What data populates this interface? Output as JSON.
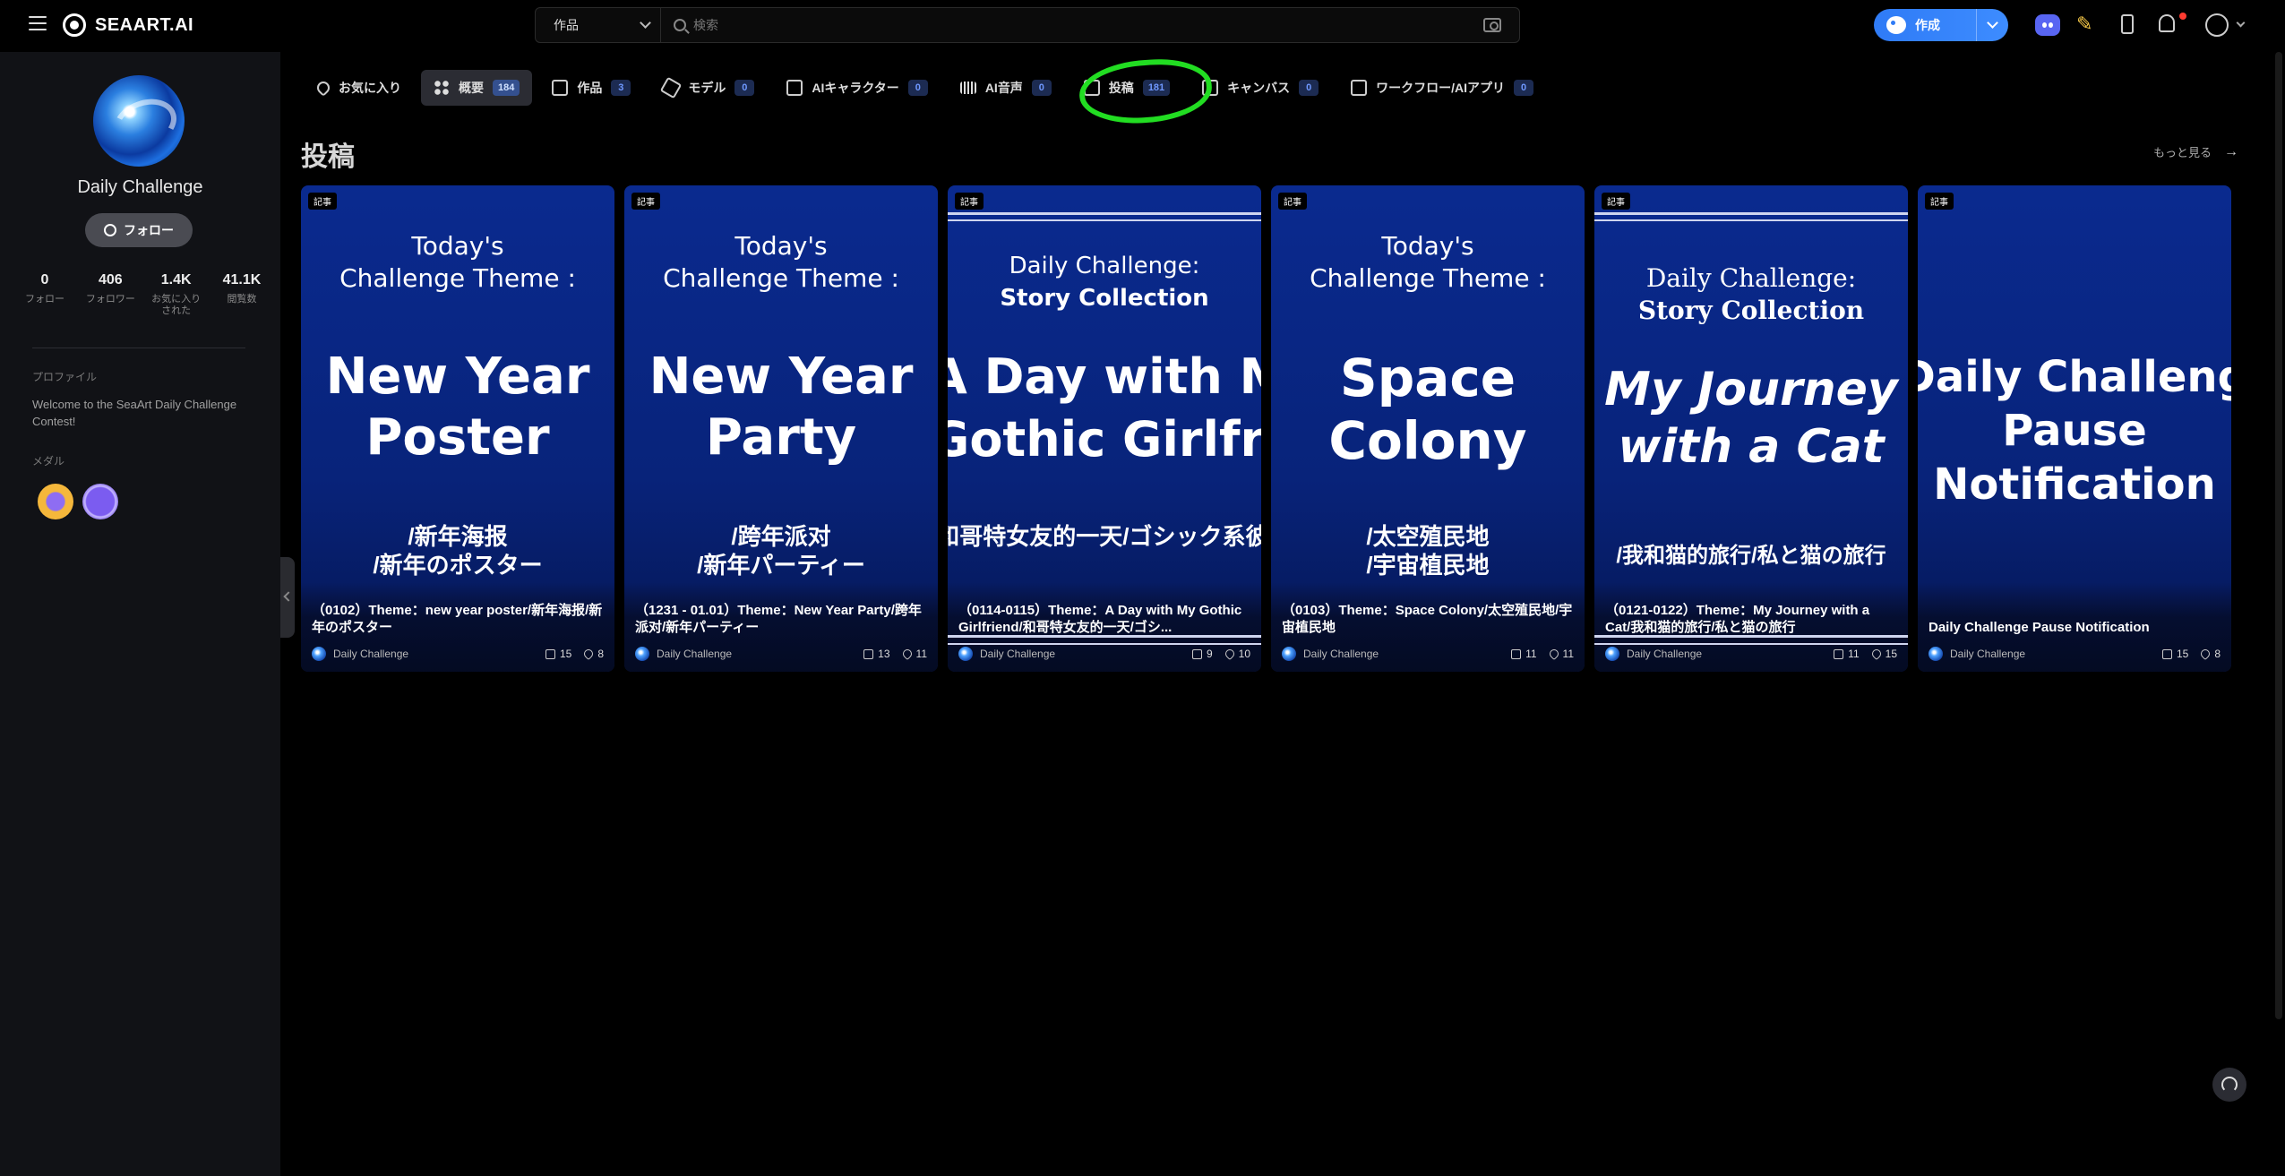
{
  "app": {
    "logo_text": "SEAART.AI"
  },
  "search": {
    "category": "作品",
    "placeholder": "検索"
  },
  "header": {
    "create_label": "作成"
  },
  "profile": {
    "name": "Daily Challenge",
    "follow_label": "フォロー",
    "stats": [
      {
        "value": "0",
        "label": "フォロー"
      },
      {
        "value": "406",
        "label": "フォロワー"
      },
      {
        "value": "1.4K",
        "label": "お気に入りされた"
      },
      {
        "value": "41.1K",
        "label": "閲覧数"
      }
    ],
    "profile_heading": "プロファイル",
    "bio": "Welcome to the SeaArt Daily Challenge Contest!",
    "medals_heading": "メダル"
  },
  "tabs": [
    {
      "label": "お気に入り",
      "count": ""
    },
    {
      "label": "概要",
      "count": "184"
    },
    {
      "label": "作品",
      "count": "3"
    },
    {
      "label": "モデル",
      "count": "0"
    },
    {
      "label": "AIキャラクター",
      "count": "0"
    },
    {
      "label": "AI音声",
      "count": "0"
    },
    {
      "label": "投稿",
      "count": "181"
    },
    {
      "label": "キャンバス",
      "count": "0"
    },
    {
      "label": "ワークフロー/AIアプリ",
      "count": "0"
    }
  ],
  "posts_section": {
    "title": "投稿",
    "more_label": "もっと見る"
  },
  "cards": [
    {
      "tag": "記事",
      "head1": "Today's",
      "head2": "Challenge Theme :",
      "big1": "New Year",
      "big2": "Poster",
      "sub1": "/新年海报",
      "sub2": "/新年のポスター",
      "caption": "（0102）Theme：new year poster/新年海报/新年のポスター",
      "author": "Daily Challenge",
      "likes": "15",
      "favs": "8"
    },
    {
      "tag": "記事",
      "head1": "Today's",
      "head2": "Challenge Theme :",
      "big1": "New Year",
      "big2": "Party",
      "sub1": "/跨年派对",
      "sub2": "/新年パーティー",
      "caption": "（1231 - 01.01）Theme：New Year Party/跨年派对/新年パーティー",
      "author": "Daily Challenge",
      "likes": "13",
      "favs": "11"
    },
    {
      "tag": "記事",
      "head1": "Daily Challenge:",
      "head2": "Story Collection",
      "big1": "A Day with My",
      "big2": "Gothic Girlfriend",
      "sub1": "/和哥特女友的一天/ゴシック系彼女と",
      "sub2": "",
      "caption": "（0114-0115）Theme：A Day with My Gothic Girlfriend/和哥特女友的一天/ゴシ...",
      "author": "Daily Challenge",
      "likes": "9",
      "favs": "10"
    },
    {
      "tag": "記事",
      "head1": "Today's",
      "head2": "Challenge Theme :",
      "big1": "Space",
      "big2": "Colony",
      "sub1": "/太空殖民地",
      "sub2": "/宇宙植民地",
      "caption": "（0103）Theme：Space Colony/太空殖民地/宇宙植民地",
      "author": "Daily Challenge",
      "likes": "11",
      "favs": "11"
    },
    {
      "tag": "記事",
      "head1": "Daily Challenge:",
      "head2": "Story Collection",
      "big1": "My Journey",
      "big2": "with a Cat",
      "sub1": "/我和猫的旅行/私と猫の旅行",
      "sub2": "",
      "caption": "（0121-0122）Theme：My Journey with a Cat/我和猫的旅行/私と猫の旅行",
      "author": "Daily Challenge",
      "likes": "11",
      "favs": "15"
    },
    {
      "tag": "記事",
      "head1": "",
      "head2": "",
      "big1": "Daily Challenge",
      "big2": "Pause",
      "big3": "Notification",
      "sub1": "",
      "sub2": "",
      "caption": "Daily Challenge Pause Notification",
      "author": "Daily Challenge",
      "likes": "15",
      "favs": "8"
    }
  ],
  "colors": {
    "accent": "#2f7bf6",
    "highlight_ring": "#22dd22",
    "card_bg": "#0a2a8f"
  }
}
